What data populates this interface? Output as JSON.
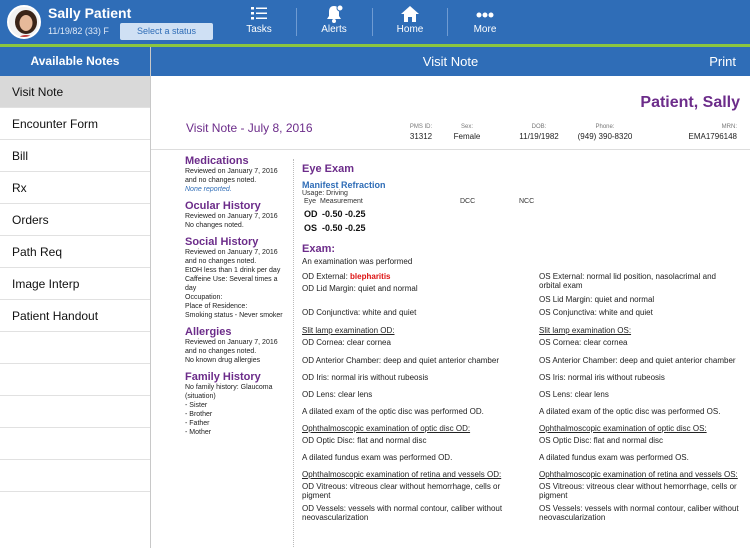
{
  "header": {
    "patient_name": "Sally Patient",
    "patient_info": "11/19/82 (33) F",
    "status_button": "Select a status",
    "nav": [
      {
        "label": "Tasks",
        "icon": "tasks-list-icon"
      },
      {
        "label": "Alerts",
        "icon": "bell-icon"
      },
      {
        "label": "Home",
        "icon": "home-icon"
      },
      {
        "label": "More",
        "icon": "more-dots-icon"
      }
    ]
  },
  "sidebar": {
    "title": "Available Notes",
    "items": [
      {
        "label": "Visit Note",
        "active": true
      },
      {
        "label": "Encounter Form"
      },
      {
        "label": "Bill"
      },
      {
        "label": "Rx"
      },
      {
        "label": "Orders"
      },
      {
        "label": "Path Req"
      },
      {
        "label": "Image Interp"
      },
      {
        "label": "Patient Handout"
      },
      {
        "label": ""
      },
      {
        "label": ""
      },
      {
        "label": ""
      },
      {
        "label": ""
      },
      {
        "label": ""
      }
    ]
  },
  "main": {
    "title": "Visit Note",
    "print_label": "Print"
  },
  "patient_header": {
    "name": "Patient, Sally",
    "visit_title": "Visit Note - July 8, 2016",
    "meta": [
      {
        "label": "PMS ID:",
        "value": "31312"
      },
      {
        "label": "Sex:",
        "value": "Female"
      },
      {
        "label": "DOB:",
        "value": "11/19/1982"
      },
      {
        "label": "Phone:",
        "value": "(949) 390-8320"
      },
      {
        "label": "MRN:",
        "value": "EMA1796148"
      }
    ]
  },
  "history": {
    "medications": {
      "title": "Medications",
      "text": "Reviewed on January 7, 2016  and no changes noted.",
      "note": "None reported."
    },
    "ocular": {
      "title": "Ocular History",
      "text": "Reviewed on January 7, 2016",
      "text2": "No changes noted."
    },
    "social": {
      "title": "Social History",
      "lines": [
        "Reviewed on January 7, 2016",
        "and no changes noted.",
        "EtOH less than 1 drink per day",
        "Caffeine Use: Several times a",
        "day",
        "Occupation:",
        "Place of Residence:",
        "Smoking status - Never smoker"
      ]
    },
    "allergies": {
      "title": "Allergies",
      "lines": [
        "Reviewed on January 7, 2016",
        "and no changes noted.",
        "No known drug allergies"
      ]
    },
    "family": {
      "title": "Family History",
      "lines": [
        "No family history: Glaucoma",
        "(situation)",
        "- Sister",
        "- Brother",
        "- Father",
        "- Mother"
      ]
    }
  },
  "eye_exam": {
    "title": "Eye Exam",
    "manifest_title": "Manifest Refraction",
    "usage": "Usage: Driving",
    "col_eye": "Eye",
    "col_measurement": "Measurement",
    "col_dcc": "DCC",
    "col_ncc": "NCC",
    "od_label": "OD",
    "od_value": "-0.50 -0.25",
    "os_label": "OS",
    "os_value": "-0.50 -0.25",
    "exam_title": "Exam:",
    "exam_intro": "An examination was performed",
    "od_external_prefix": "OD External:",
    "od_external_value": "blepharitis",
    "os_external": "OS External: normal lid position, nasolacrimal and orbital exam",
    "od_lid": "OD Lid Margin: quiet and normal",
    "os_lid": "OS Lid Margin: quiet and normal",
    "od_conj": "OD Conjunctiva: white and quiet",
    "os_conj": "OS Conjunctiva: white and quiet",
    "od_slit": "Slit lamp examination OD:",
    "os_slit": "Slit lamp examination OS:",
    "od_cornea": "OD Cornea: clear cornea",
    "os_cornea": "OS Cornea: clear cornea",
    "od_ac": "OD Anterior Chamber: deep and quiet anterior chamber",
    "os_ac": "OS Anterior Chamber: deep and quiet anterior chamber",
    "od_iris": "OD Iris: normal iris without rubeosis",
    "os_iris": "OS Iris: normal iris without rubeosis",
    "od_lens": "OD Lens: clear lens",
    "os_lens": "OS Lens: clear lens",
    "od_dilated": "A dilated exam of the optic disc was performed OD.",
    "os_dilated": "A dilated exam of the optic disc was performed OS.",
    "od_oph_disc": "Ophthalmoscopic examination of optic disc OD:",
    "os_oph_disc": "Ophthalmoscopic examination of optic disc OS:",
    "od_optic": "OD Optic Disc: flat and normal disc",
    "os_optic": "OS Optic Disc: flat and normal disc",
    "od_fundus": "A dilated fundus exam was performed OD.",
    "os_fundus": "A dilated fundus exam was performed OS.",
    "od_oph_ret": "Ophthalmoscopic examination of retina and vessels OD:",
    "os_oph_ret": "Ophthalmoscopic examination of retina and vessels OS:",
    "od_vitreous": "OD Vitreous: vitreous clear without hemorrhage, cells or pigment",
    "os_vitreous": "OS Vitreous: vitreous clear without hemorrhage, cells or pigment",
    "od_vessels": "OD Vessels: vessels with normal contour, caliber without neovascularization",
    "os_vessels": "OS Vessels: vessels with normal contour, caliber without neovascularization"
  }
}
